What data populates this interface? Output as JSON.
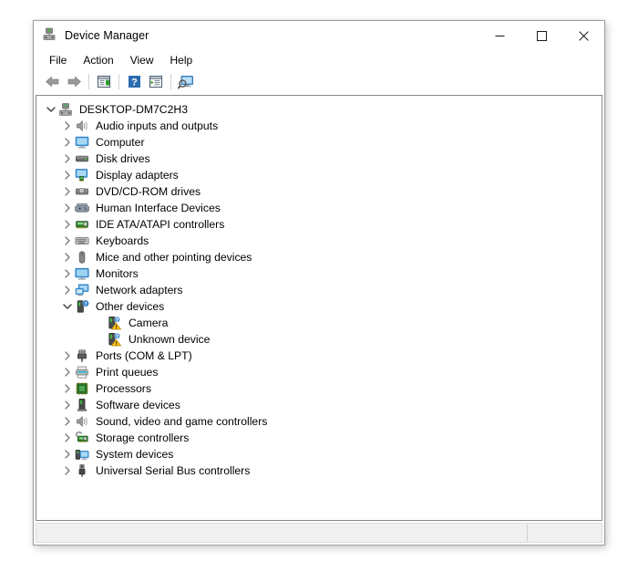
{
  "window": {
    "title": "Device Manager",
    "title_icon": "device-manager-icon",
    "controls": {
      "minimize": "minimize-icon",
      "maximize": "maximize-icon",
      "close": "close-icon"
    }
  },
  "menubar": {
    "items": [
      {
        "label": "File",
        "name": "menu-file"
      },
      {
        "label": "Action",
        "name": "menu-action"
      },
      {
        "label": "View",
        "name": "menu-view"
      },
      {
        "label": "Help",
        "name": "menu-help"
      }
    ]
  },
  "toolbar": {
    "buttons": [
      {
        "name": "back-button",
        "icon": "back-arrow-icon",
        "tooltip": "Back"
      },
      {
        "name": "forward-button",
        "icon": "forward-arrow-icon",
        "tooltip": "Forward"
      },
      {
        "name": "properties-button",
        "icon": "properties-icon",
        "tooltip": "Properties"
      },
      {
        "name": "help-button",
        "icon": "help-question-icon",
        "tooltip": "Help"
      },
      {
        "name": "update-driver-button",
        "icon": "update-driver-icon",
        "tooltip": "Update driver"
      },
      {
        "name": "scan-hardware-button",
        "icon": "scan-hardware-changes-icon",
        "tooltip": "Scan for hardware changes"
      }
    ]
  },
  "tree": {
    "root": {
      "label": "DESKTOP-DM7C2H3",
      "icon": "computer-root-icon",
      "expanded": true
    },
    "nodes": [
      {
        "label": "Audio inputs and outputs",
        "icon": "speaker-icon",
        "expanded": false,
        "depth": 1
      },
      {
        "label": "Computer",
        "icon": "computer-monitor-icon",
        "expanded": false,
        "depth": 1
      },
      {
        "label": "Disk drives",
        "icon": "disk-drive-icon",
        "expanded": false,
        "depth": 1
      },
      {
        "label": "Display adapters",
        "icon": "display-adapter-icon",
        "expanded": false,
        "depth": 1
      },
      {
        "label": "DVD/CD-ROM drives",
        "icon": "dvd-drive-icon",
        "expanded": false,
        "depth": 1
      },
      {
        "label": "Human Interface Devices",
        "icon": "hid-gamepad-icon",
        "expanded": false,
        "depth": 1
      },
      {
        "label": "IDE ATA/ATAPI controllers",
        "icon": "ide-controller-icon",
        "expanded": false,
        "depth": 1
      },
      {
        "label": "Keyboards",
        "icon": "keyboard-icon",
        "expanded": false,
        "depth": 1
      },
      {
        "label": "Mice and other pointing devices",
        "icon": "mouse-icon",
        "expanded": false,
        "depth": 1
      },
      {
        "label": "Monitors",
        "icon": "monitor-icon",
        "expanded": false,
        "depth": 1
      },
      {
        "label": "Network adapters",
        "icon": "network-adapter-icon",
        "expanded": false,
        "depth": 1
      },
      {
        "label": "Other devices",
        "icon": "unknown-device-question-icon",
        "expanded": true,
        "depth": 1
      },
      {
        "label": "Camera",
        "icon": "unknown-device-warning-icon",
        "expanded": null,
        "depth": 2,
        "warning": true
      },
      {
        "label": "Unknown device",
        "icon": "unknown-device-warning-icon",
        "expanded": null,
        "depth": 2,
        "warning": true
      },
      {
        "label": "Ports (COM & LPT)",
        "icon": "port-connector-icon",
        "expanded": false,
        "depth": 1
      },
      {
        "label": "Print queues",
        "icon": "printer-icon",
        "expanded": false,
        "depth": 1
      },
      {
        "label": "Processors",
        "icon": "processor-chip-icon",
        "expanded": false,
        "depth": 1
      },
      {
        "label": "Software devices",
        "icon": "software-device-icon",
        "expanded": false,
        "depth": 1
      },
      {
        "label": "Sound, video and game controllers",
        "icon": "speaker-icon",
        "expanded": false,
        "depth": 1
      },
      {
        "label": "Storage controllers",
        "icon": "storage-controller-icon",
        "expanded": false,
        "depth": 1
      },
      {
        "label": "System devices",
        "icon": "system-device-icon",
        "expanded": false,
        "depth": 1
      },
      {
        "label": "Universal Serial Bus controllers",
        "icon": "usb-connector-icon",
        "expanded": false,
        "depth": 1
      }
    ]
  },
  "statusbar": {
    "text": ""
  },
  "colors": {
    "window_border": "#a0a0a0",
    "tree_border": "#828790",
    "status_bg": "#f0f0f0",
    "warning_yellow": "#ffc40c",
    "accent_blue": "#0078d7",
    "chevron_gray": "#7a7a7a"
  }
}
